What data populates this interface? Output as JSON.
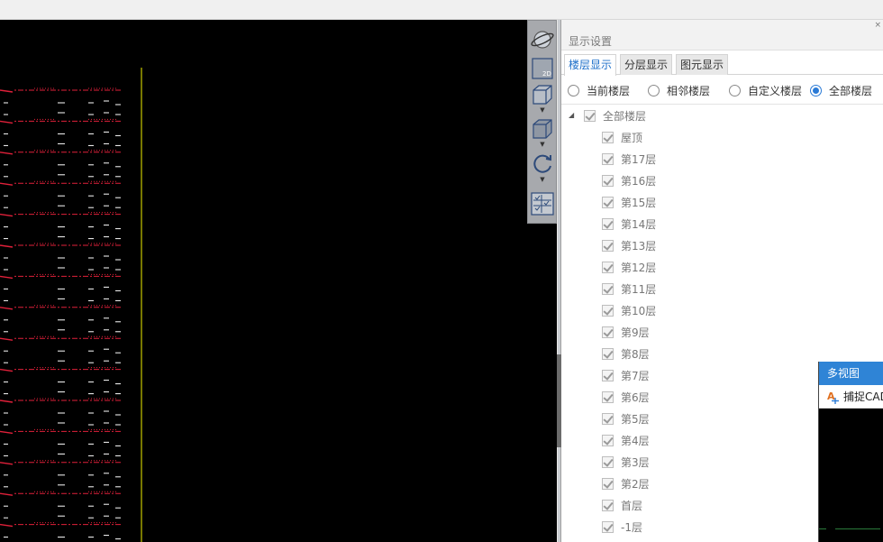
{
  "panel": {
    "title": "显示设置",
    "close_glyph": "×",
    "tabs": [
      {
        "label": "楼层显示",
        "active": true
      },
      {
        "label": "分层显示",
        "active": false
      },
      {
        "label": "图元显示",
        "active": false
      }
    ],
    "radio_options": [
      {
        "label": "当前楼层",
        "checked": false
      },
      {
        "label": "相邻楼层",
        "checked": false
      },
      {
        "label": "自定义楼层",
        "checked": false
      },
      {
        "label": "全部楼层",
        "checked": true
      }
    ],
    "tree": {
      "root": {
        "label": "全部楼层",
        "checked": true,
        "expanded": true
      },
      "items": [
        {
          "label": "屋顶",
          "checked": true
        },
        {
          "label": "第17层",
          "checked": true
        },
        {
          "label": "第16层",
          "checked": true
        },
        {
          "label": "第15层",
          "checked": true
        },
        {
          "label": "第14层",
          "checked": true
        },
        {
          "label": "第13层",
          "checked": true
        },
        {
          "label": "第12层",
          "checked": true
        },
        {
          "label": "第11层",
          "checked": true
        },
        {
          "label": "第10层",
          "checked": true
        },
        {
          "label": "第9层",
          "checked": true
        },
        {
          "label": "第8层",
          "checked": true
        },
        {
          "label": "第7层",
          "checked": true
        },
        {
          "label": "第6层",
          "checked": true
        },
        {
          "label": "第5层",
          "checked": true
        },
        {
          "label": "第4层",
          "checked": true
        },
        {
          "label": "第3层",
          "checked": true
        },
        {
          "label": "第2层",
          "checked": true
        },
        {
          "label": "首层",
          "checked": true
        },
        {
          "label": "-1层",
          "checked": true
        }
      ]
    }
  },
  "toolbar": {
    "tools": [
      {
        "icon": "orbit-globe-icon"
      },
      {
        "icon": "2d-view-icon",
        "text": "2D"
      },
      {
        "icon": "3d-box-icon",
        "has_dropdown": true
      },
      {
        "icon": "3d-solid-icon",
        "has_dropdown": true
      },
      {
        "icon": "rotate-icon",
        "has_dropdown": true
      },
      {
        "icon": "layer-list-icon"
      }
    ]
  },
  "multiview": {
    "title": "多视图",
    "capture_label": "捕捉CAD"
  },
  "colors": {
    "accent": "#2f84d6",
    "cad_red": "#e0203a",
    "cad_yellow": "#c8c800",
    "cad_white": "#ffffff"
  }
}
